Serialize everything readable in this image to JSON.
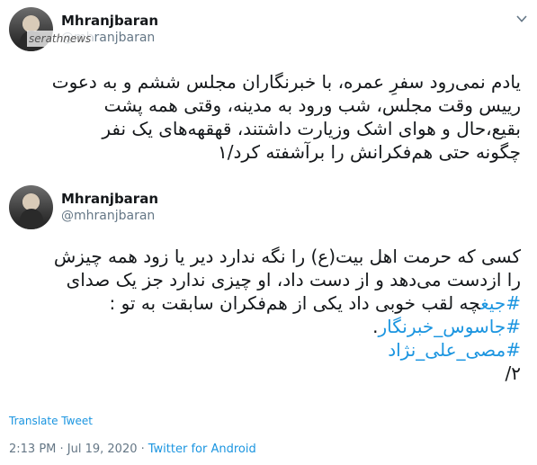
{
  "tweets": [
    {
      "display_name": "Mhranjbaran",
      "handle": "@mhranjbaran",
      "watermark": "serathnews",
      "text_lines": [
        "یادم نمی‌رود سفرِ عمره، با خبرنگاران مجلس ششم و به دعوت",
        "رییس وقت مجلس، شب ورود به مدینه، وقتی همه پشت",
        "بقیع،حال و هوای اشک وزیارت داشتند، قهقهه‌های یک نفر",
        "چگونه حتی هم‌فکرانش را برآشفته کرد/۱"
      ]
    },
    {
      "display_name": "Mhranjbaran",
      "handle": "@mhranjbaran",
      "text_lines": [
        "کسی که حرمت اهل بیت(ع) را نگه ندارد دیر یا زود همه چیزش",
        "را ازدست می‌دهد و از دست داد، او چیزی ندارد جز یک صدای",
        "چه لقب خوبی داد یکی از هم‌فکران سابقت به تو :"
      ],
      "hashtag_inline": "#جیغ",
      "hashtags": [
        "#جاسوس_خبرنگار",
        "#مصی_علی_نژاد"
      ],
      "hashtag_suffix": ".",
      "closing": "۲/"
    }
  ],
  "translate_label": "Translate Tweet",
  "timestamp": "2:13 PM · Jul 19, 2020 ·",
  "source": "Twitter for Android",
  "colors": {
    "link": "#1b95e0",
    "text": "#14171a",
    "muted": "#657786"
  },
  "icons": {
    "menu": "chevron-down-icon"
  }
}
